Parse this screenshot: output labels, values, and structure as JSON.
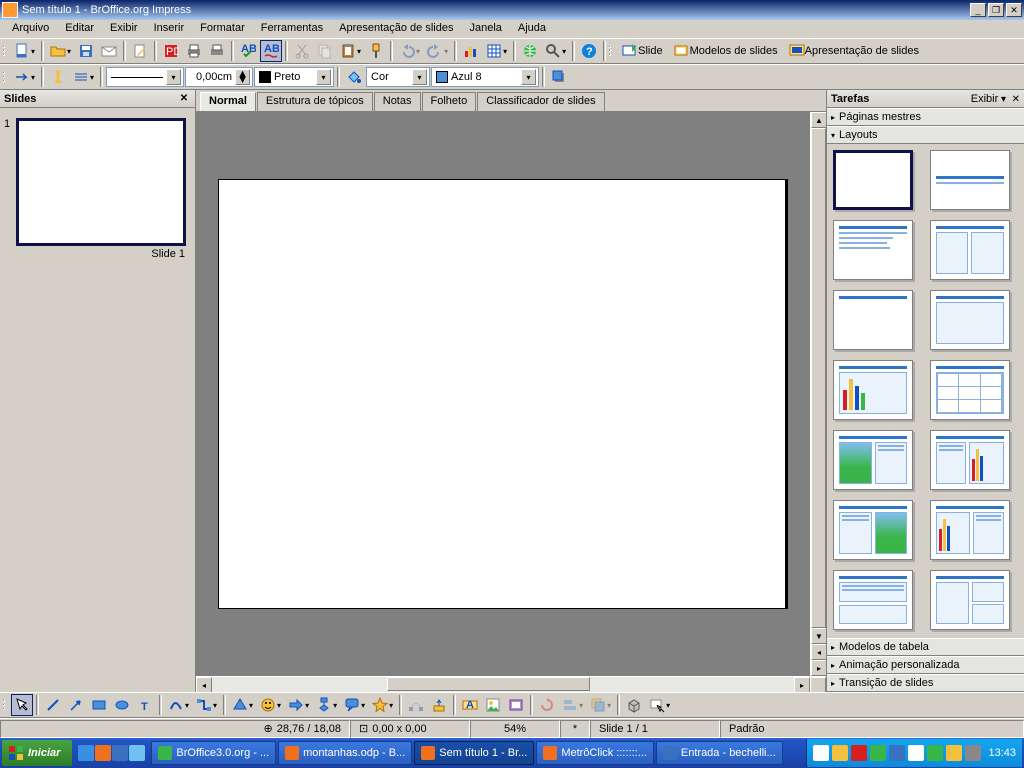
{
  "title": "Sem título 1 - BrOffice.org Impress",
  "menu": [
    "Arquivo",
    "Editar",
    "Exibir",
    "Inserir",
    "Formatar",
    "Ferramentas",
    "Apresentação de slides",
    "Janela",
    "Ajuda"
  ],
  "toolbar2": {
    "width": "0,00cm",
    "lineColorLabel": "Preto",
    "fillLabel": "Cor",
    "fillColor": "Azul 8"
  },
  "sideButtons": {
    "slide": "Slide",
    "models": "Modelos de slides",
    "present": "Apresentação de slides"
  },
  "slidesPanel": {
    "title": "Slides",
    "slide1": "Slide 1"
  },
  "viewTabs": [
    "Normal",
    "Estrutura de tópicos",
    "Notas",
    "Folheto",
    "Classificador de slides"
  ],
  "taskPane": {
    "title": "Tarefas",
    "exibir": "Exibir",
    "sections": {
      "mestres": "Páginas mestres",
      "layouts": "Layouts",
      "tabela": "Modelos de tabela",
      "anim": "Animação personalizada",
      "trans": "Transição de slides"
    }
  },
  "status": {
    "pos": "28,76 / 18,08",
    "size": "0,00 x 0,00",
    "zoom": "54%",
    "star": "*",
    "slide": "Slide 1 / 1",
    "style": "Padrão"
  },
  "taskbar": {
    "start": "Iniciar",
    "items": [
      "BrOffice3.0.org - ...",
      "montanhas.odp - B...",
      "Sem título 1 - Br...",
      "MetrôClick :::::::...",
      "Entrada - bechelli..."
    ],
    "clock": "13:43"
  }
}
